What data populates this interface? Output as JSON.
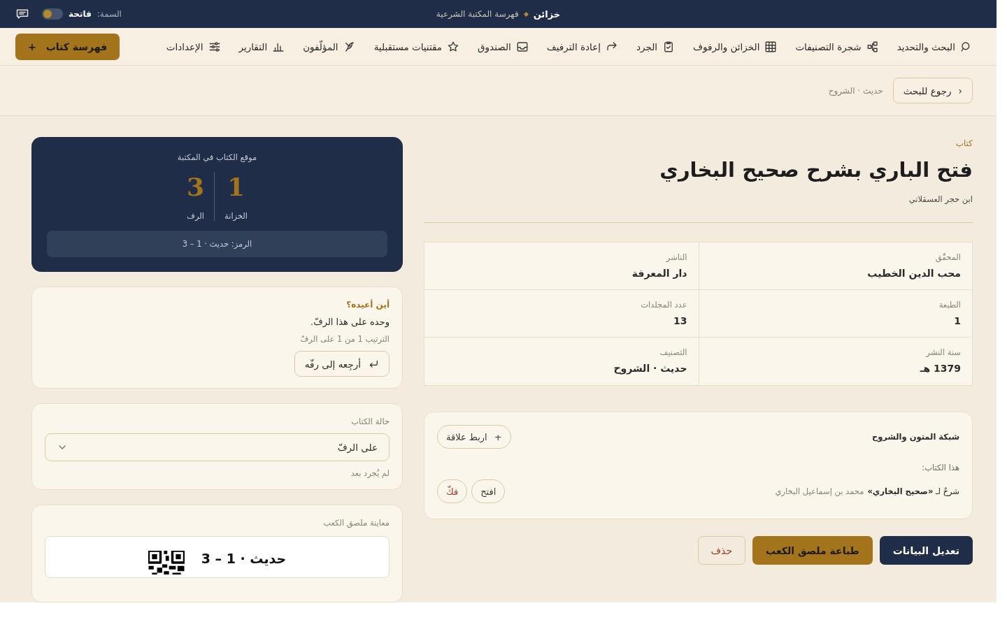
{
  "topbar": {
    "brand": "خزائن",
    "subtitle": "فهرسة المكتبة الشرعية",
    "theme": {
      "label": "السمة:",
      "value": "فاتحة",
      "dark_mode": false
    }
  },
  "nav": {
    "items": [
      {
        "label": "البحث والتحديد",
        "kind": "search"
      },
      {
        "label": "شجرة التصنيفات",
        "kind": "tree"
      },
      {
        "label": "الخزائن والرفوف",
        "kind": "shelves"
      },
      {
        "label": "الجرد",
        "kind": "inventory"
      },
      {
        "label": "إعادة الترفيف",
        "kind": "reshelve"
      },
      {
        "label": "الصندوق",
        "kind": "box"
      },
      {
        "label": "مقتنيات مستقبلية",
        "kind": "wishlist"
      },
      {
        "label": "المؤلّفون",
        "kind": "authors"
      },
      {
        "label": "التقارير",
        "kind": "reports"
      },
      {
        "label": "الإعدادات",
        "kind": "settings"
      }
    ],
    "add_button": {
      "icon": "+",
      "label": "فهرسة كتاب"
    }
  },
  "crumbs": {
    "back_button": {
      "chevron": "‹",
      "label": "رجوع للبحث"
    },
    "path": "حديث · الشروح"
  },
  "book": {
    "type_label": "كتاب",
    "title": "فتح الباري بشرح صحيح البخاري",
    "author": "ابن حجر العسقلاني",
    "details": [
      {
        "label": "المحقّق",
        "value": "محب الدين الخطيب"
      },
      {
        "label": "الناشر",
        "value": "دار المعرفة"
      },
      {
        "label": "الطبعة",
        "value": "1"
      },
      {
        "label": "عدد المجلدات",
        "value": "13"
      },
      {
        "label": "سنة النشر",
        "value": "1379 هـ"
      },
      {
        "label": "التصنيف",
        "value": "حديث · الشروح"
      }
    ]
  },
  "network": {
    "title": "شبكة المتون والشروح",
    "link_button": {
      "icon": "+",
      "label": "اربط علاقة"
    },
    "subtitle": "هذا الكتاب:",
    "relations": [
      {
        "text": "شرحٌ لـ **«صحيح البخاري»**",
        "author": "محمد بن إسماعيل البخاري",
        "open_label": "افتح",
        "unlink_label": "فكّ"
      }
    ]
  },
  "actions": [
    {
      "label": "تعديل البيانات",
      "kind": "primary"
    },
    {
      "label": "طباعة ملصق الكعب",
      "kind": "accent"
    },
    {
      "label": "حذف",
      "kind": "danger"
    }
  ],
  "location": {
    "title": "موقع الكتاب في المكتبة",
    "cells": [
      {
        "value": "1",
        "label": "الخزانة"
      },
      {
        "value": "3",
        "label": "الرف"
      }
    ],
    "code": "الرمز: حديث · 1 – 3"
  },
  "return_card": {
    "title": "أين أعيده؟",
    "message": "وحده على هذا الرفّ.",
    "position": "الترتيب 1 من 1 على الرفّ",
    "button_label": "أرجِعه إلى رفّه"
  },
  "status": {
    "label": "حالة الكتاب",
    "value": "على الرفّ",
    "note": "لم يُجرد بعد"
  },
  "label_preview": {
    "title": "معاينة ملصق الكعب",
    "text": "حديث · 1 – 3"
  }
}
